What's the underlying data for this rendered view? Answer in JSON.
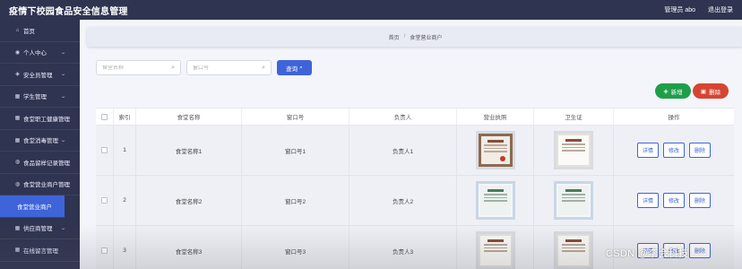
{
  "header": {
    "app_title": "疫情下校园食品安全信息管理",
    "user_label": "管理员 abo",
    "logout_label": "退出登录"
  },
  "sidebar": {
    "items": [
      {
        "label": "首页",
        "icon": "home-icon",
        "glyph": "⌂",
        "arrow": false
      },
      {
        "label": "个人中心",
        "icon": "user-icon",
        "glyph": "◉",
        "arrow": true
      },
      {
        "label": "安全员管理",
        "icon": "shield-icon",
        "glyph": "◈",
        "arrow": true
      },
      {
        "label": "学生管理",
        "icon": "grid-icon",
        "glyph": "▦",
        "arrow": true
      },
      {
        "label": "食堂职工健康管理",
        "icon": "grid-icon",
        "glyph": "▦",
        "arrow": true
      },
      {
        "label": "食堂消毒管理",
        "icon": "grid-icon",
        "glyph": "▦",
        "arrow": true
      },
      {
        "label": "食品留样记录管理",
        "icon": "pin-icon",
        "glyph": "◍",
        "arrow": true
      },
      {
        "label": "食堂营业商户管理",
        "icon": "pin-icon",
        "glyph": "◍",
        "arrow": true
      },
      {
        "label": "食堂营业商户",
        "icon": "",
        "glyph": "",
        "arrow": false,
        "active": true
      },
      {
        "label": "供应商管理",
        "icon": "grid-icon",
        "glyph": "▦",
        "arrow": true
      },
      {
        "label": "在线留言管理",
        "icon": "grid-icon",
        "glyph": "▦",
        "arrow": false
      }
    ]
  },
  "breadcrumb": {
    "home": "首页",
    "separator": "/",
    "current": "食堂营业商户"
  },
  "search": {
    "name_placeholder": "食堂名称",
    "window_placeholder": "窗口号",
    "button_label": "查询"
  },
  "toolbar": {
    "add_label": "新增",
    "delete_label": "删除"
  },
  "table": {
    "columns": [
      "索引",
      "食堂名称",
      "窗口号",
      "负责人",
      "营业执照",
      "卫生证",
      "操作"
    ],
    "rows": [
      {
        "index": "1",
        "name": "食堂名称1",
        "window": "窗口号1",
        "manager": "负责人1",
        "license_style": "framed",
        "health_style": "white"
      },
      {
        "index": "2",
        "name": "食堂名称2",
        "window": "窗口号2",
        "manager": "负责人2",
        "license_style": "blue",
        "health_style": "blue"
      },
      {
        "index": "3",
        "name": "食堂名称3",
        "window": "窗口号3",
        "manager": "负责人3",
        "license_style": "white",
        "health_style": "white"
      }
    ],
    "actions": {
      "detail": "详情",
      "edit": "修改",
      "delete": "删除"
    }
  },
  "watermark": "CSDN @李会科技",
  "colors": {
    "nav_bg": "#2f3450",
    "accent": "#3f63d9",
    "add": "#1f9e4a",
    "delete": "#d64532"
  }
}
